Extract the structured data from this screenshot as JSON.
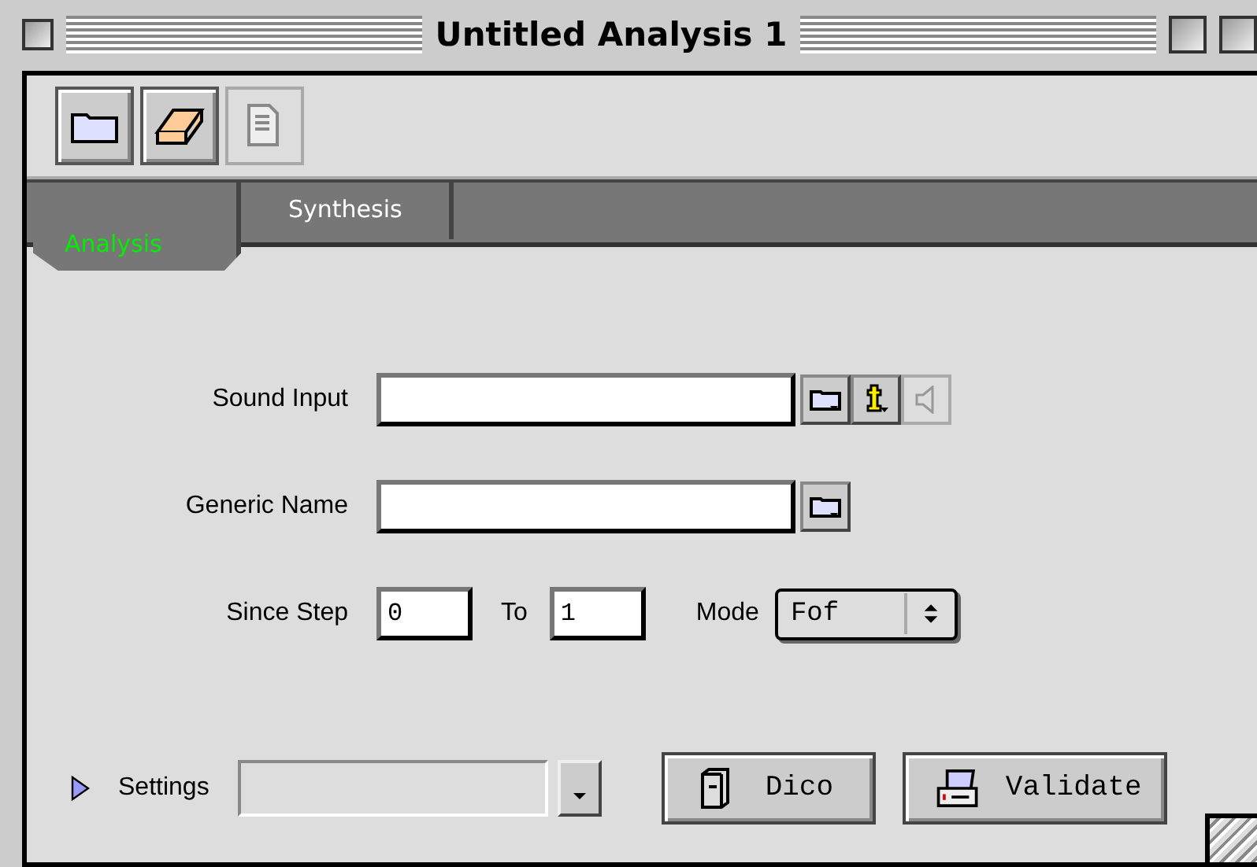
{
  "window": {
    "title": "Untitled Analysis 1"
  },
  "toolbar": [
    {
      "kind": "folder",
      "disabled": false
    },
    {
      "kind": "eraser",
      "disabled": false
    },
    {
      "kind": "document",
      "disabled": true
    }
  ],
  "tabs": [
    {
      "label": "Analysis",
      "selected": true
    },
    {
      "label": "Synthesis",
      "selected": false
    }
  ],
  "fields": [
    {
      "label": "Sound Input",
      "tools": [
        {
          "kind": "folder",
          "disabled": false
        },
        {
          "kind": "info",
          "disabled": false
        },
        {
          "kind": "speaker",
          "disabled": true
        }
      ]
    },
    {
      "label": "Generic Name",
      "tools": [
        {
          "kind": "folder",
          "disabled": false
        }
      ]
    }
  ],
  "step": {
    "label": "Since Step",
    "from": "0",
    "to_label": "To",
    "to": "1",
    "mode_label": "Mode",
    "mode": "Fof"
  },
  "settings": {
    "label": "Settings",
    "expanded": false
  },
  "buttons": [
    {
      "label": "Dico",
      "kind": "book"
    },
    {
      "label": "Validate",
      "kind": "printer"
    }
  ]
}
